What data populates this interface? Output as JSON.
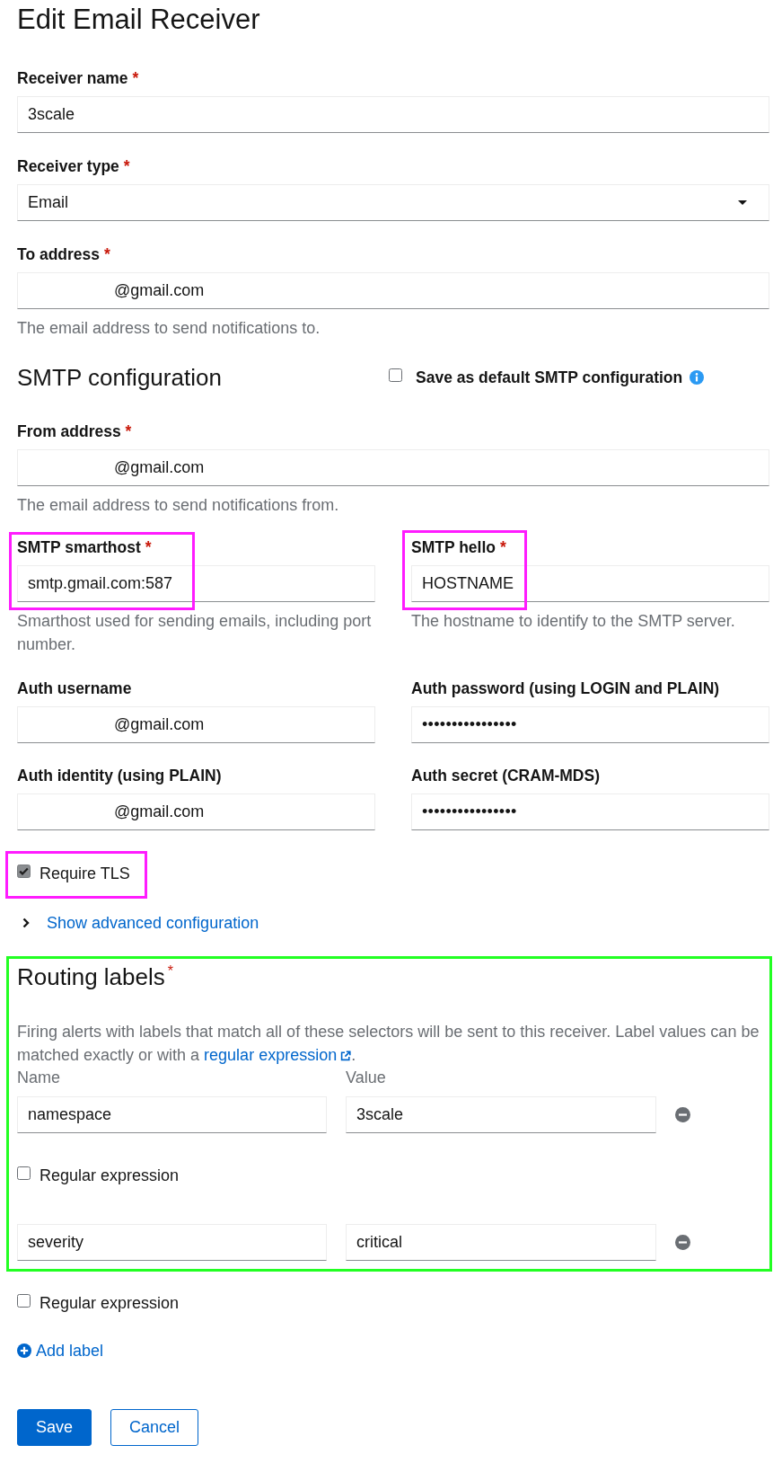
{
  "title": "Edit Email Receiver",
  "receiver": [
    {
      "kind": "text",
      "label": "Receiver name",
      "required_mark": "*",
      "value": "3scale",
      "redacted": false
    },
    {
      "kind": "select",
      "label": "Receiver type",
      "required_mark": "*",
      "value": "Email"
    },
    {
      "kind": "text",
      "label": "To address",
      "required_mark": "*",
      "value": "@gmail.com",
      "redacted": true,
      "helper": "The email address to send notifications to."
    }
  ],
  "smtp": {
    "heading": "SMTP configuration",
    "save_default": {
      "label": "Save as default SMTP configuration",
      "checked": false
    },
    "from_address": {
      "kind": "text",
      "label": "From address",
      "required_mark": "*",
      "value": "@gmail.com",
      "redacted": true,
      "helper": "The email address to send notifications from."
    },
    "fields": [
      {
        "kind": "text",
        "label": "SMTP smarthost",
        "required_mark": "*",
        "value": "smtp.gmail.com:587",
        "redacted": false,
        "helper": "Smarthost used for sending emails, including port number.",
        "highlighted": true
      },
      {
        "kind": "text",
        "label": "SMTP hello",
        "required_mark": "*",
        "value": "HOSTNAME",
        "redacted": false,
        "helper": "The hostname to identify to the SMTP server.",
        "highlighted": true
      },
      {
        "kind": "text",
        "label": "Auth username",
        "value": "@gmail.com",
        "redacted": true,
        "highlighted": false
      },
      {
        "kind": "password",
        "label": "Auth password (using LOGIN and PLAIN)",
        "value": "••••••••••••••••",
        "highlighted": false
      },
      {
        "kind": "text",
        "label": "Auth identity (using PLAIN)",
        "value": "@gmail.com",
        "redacted": true,
        "highlighted": false
      },
      {
        "kind": "password",
        "label": "Auth secret (CRAM-MDS)",
        "value": "••••••••••••••••",
        "highlighted": false
      }
    ],
    "require_tls": {
      "label": "Require TLS",
      "checked": true,
      "highlighted": true
    },
    "advanced": {
      "label": "Show advanced configuration",
      "expanded": false
    }
  },
  "routing": {
    "heading": "Routing labels",
    "required_mark": "*",
    "highlighted": true,
    "description": {
      "text": "Firing alerts with labels that match all of these selectors will be sent to this receiver. Label values can be matched exactly or with a ",
      "link": "regular expression",
      "after": "."
    },
    "column_headers": [
      "Name",
      "Value"
    ],
    "labels": [
      {
        "name": "namespace",
        "value": "3scale",
        "regex": {
          "label": "Regular expression",
          "checked": false
        }
      },
      {
        "name": "severity",
        "value": "critical",
        "regex": {
          "label": "Regular expression",
          "checked": false
        }
      }
    ],
    "add_label": "Add label"
  },
  "buttons": [
    {
      "kind": "primary",
      "label": "Save"
    },
    {
      "kind": "secondary",
      "label": "Cancel"
    }
  ]
}
